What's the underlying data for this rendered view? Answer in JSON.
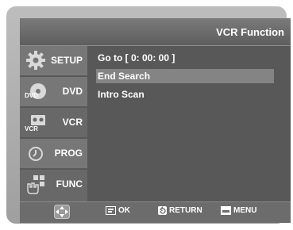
{
  "header": {
    "title": "VCR Function"
  },
  "sidebar": {
    "items": [
      {
        "label": "SETUP",
        "icon": "gear-icon"
      },
      {
        "label": "DVD",
        "icon": "dvd-disc-icon",
        "icon_text": "DVD"
      },
      {
        "label": "VCR",
        "icon": "vcr-cassette-icon",
        "icon_text": "VCR"
      },
      {
        "label": "PROG",
        "icon": "clock-icon"
      },
      {
        "label": "FUNC",
        "icon": "hand-icon"
      }
    ]
  },
  "menu": {
    "items": [
      {
        "label": "Go to  [ 0: 00: 00 ]"
      },
      {
        "label": "End Search",
        "selected": true
      },
      {
        "label": "Intro Scan"
      }
    ]
  },
  "footer": {
    "nav_icon": "dpad-icon",
    "ok_label": "OK",
    "return_label": "RETURN",
    "menu_label": "MENU"
  },
  "colors": {
    "osd_background": "#585858",
    "selected_row": "#848484",
    "text": "#ffffff"
  }
}
